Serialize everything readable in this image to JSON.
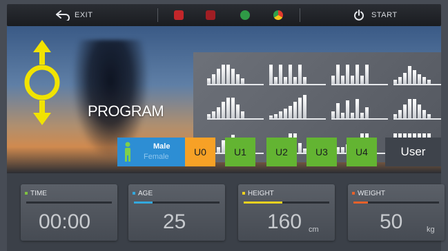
{
  "topbar": {
    "exit_label": "EXIT",
    "start_label": "START"
  },
  "hero": {
    "program_label": "PROGRAM"
  },
  "gender": {
    "male": "Male",
    "female": "Female"
  },
  "user_slots": [
    "U0",
    "U1",
    "U2",
    "U3",
    "U4"
  ],
  "user_label": "User",
  "cards": [
    {
      "label": "TIME",
      "value": "00:00",
      "unit": "",
      "color": "#7fc241",
      "fill": 0.0
    },
    {
      "label": "AGE",
      "value": "25",
      "unit": "",
      "color": "#33a8dd",
      "fill": 0.22
    },
    {
      "label": "HEIGHT",
      "value": "160",
      "unit": "cm",
      "color": "#f0d21f",
      "fill": 0.45
    },
    {
      "label": "WEIGHT",
      "value": "50",
      "unit": "kg",
      "color": "#e8612a",
      "fill": 0.17
    }
  ],
  "colors": {
    "accent_yellow": "#f1e300",
    "gender_blue": "#2d8ed4",
    "slot_orange": "#f7a126",
    "slot_green": "#63b432"
  }
}
